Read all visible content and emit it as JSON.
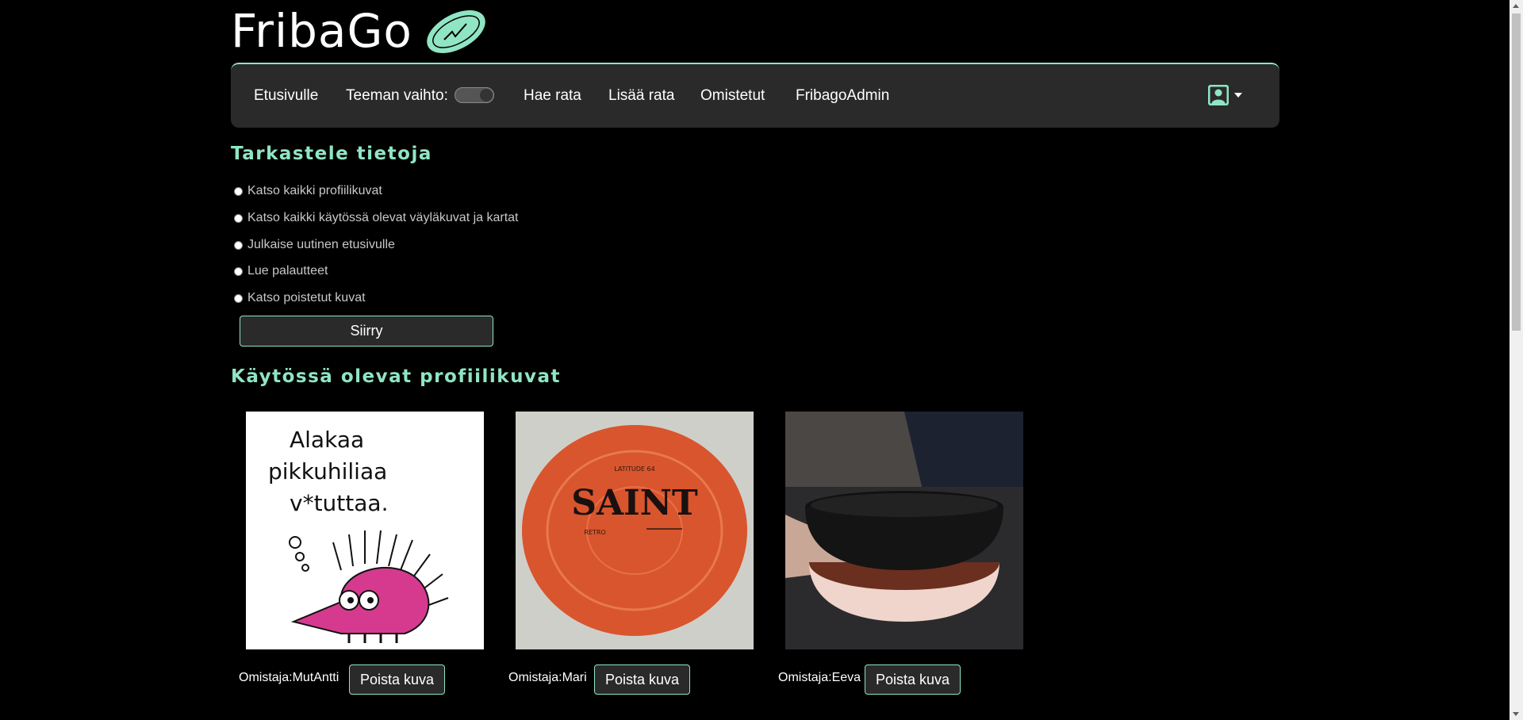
{
  "brand": {
    "name": "FribaGo",
    "logo_icon": "disc-logo-icon",
    "accent": "#8fe5c4"
  },
  "nav": {
    "home": "Etusivulle",
    "theme_label": "Teeman vaihto:",
    "search_course": "Hae rata",
    "add_course": "Lisää rata",
    "owned": "Omistetut",
    "admin": "FribagoAdmin",
    "user_icon": "user-portrait-icon"
  },
  "view_section": {
    "title": "Tarkastele tietoja",
    "options": [
      "Katso kaikki profiilikuvat",
      "Katso kaikki käytössä olevat väyläkuvat ja kartat",
      "Julkaise uutinen etusivulle",
      "Lue palautteet",
      "Katso poistetut kuvat"
    ],
    "submit": "Siirry"
  },
  "profile_section": {
    "title": "Käytössä olevat profiilikuvat",
    "cards": [
      {
        "owner": "Omistaja:MutAntti",
        "delete": "Poista kuva",
        "image": "hedgehog-cartoon-image",
        "caption_lines": [
          "Alakaa",
          "pikkuhiliaa",
          "v*tuttaa."
        ]
      },
      {
        "owner": "Omistaja:Mari",
        "delete": "Poista kuva",
        "image": "orange-disc-photo",
        "disc_text": "SAINT",
        "disc_brand": "LATITUDE 64",
        "disc_sub": "RETRO"
      },
      {
        "owner": "Omistaja:Eeva",
        "delete": "Poista kuva",
        "image": "bowl-photo"
      }
    ]
  }
}
